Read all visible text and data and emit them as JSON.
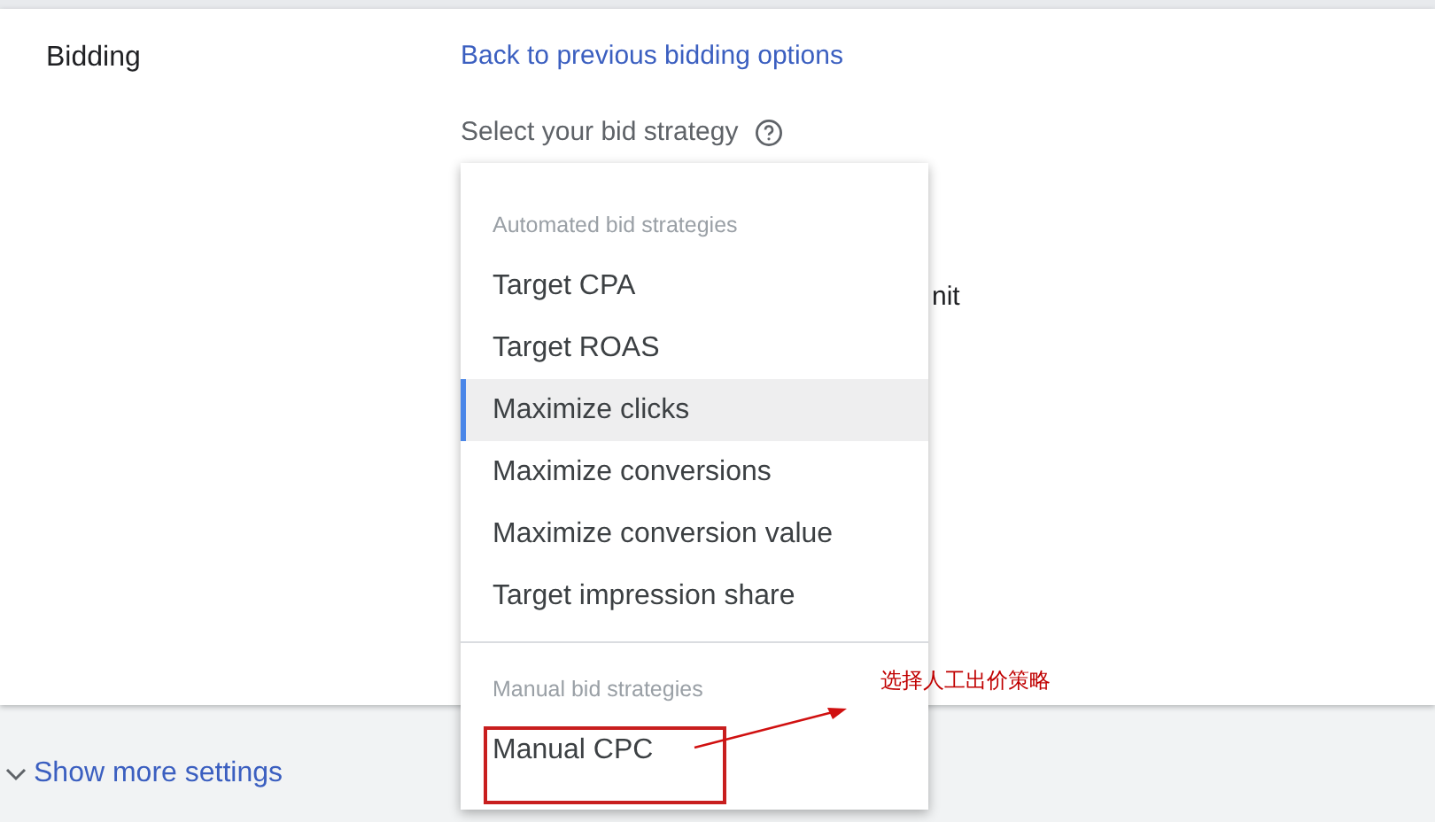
{
  "section": {
    "label": "Bidding",
    "back_link": "Back to previous bidding options",
    "select_label": "Select your bid strategy",
    "hidden_text": "nit"
  },
  "dropdown": {
    "groups": [
      {
        "heading": "Automated bid strategies",
        "items": [
          {
            "label": "Target CPA",
            "selected": false
          },
          {
            "label": "Target ROAS",
            "selected": false
          },
          {
            "label": "Maximize clicks",
            "selected": true
          },
          {
            "label": "Maximize conversions",
            "selected": false
          },
          {
            "label": "Maximize conversion value",
            "selected": false
          },
          {
            "label": "Target impression share",
            "selected": false
          }
        ]
      },
      {
        "heading": "Manual bid strategies",
        "items": [
          {
            "label": "Manual CPC",
            "selected": false
          }
        ]
      }
    ]
  },
  "show_more": "Show more settings",
  "annotation": {
    "text": "选择人工出价策略"
  }
}
